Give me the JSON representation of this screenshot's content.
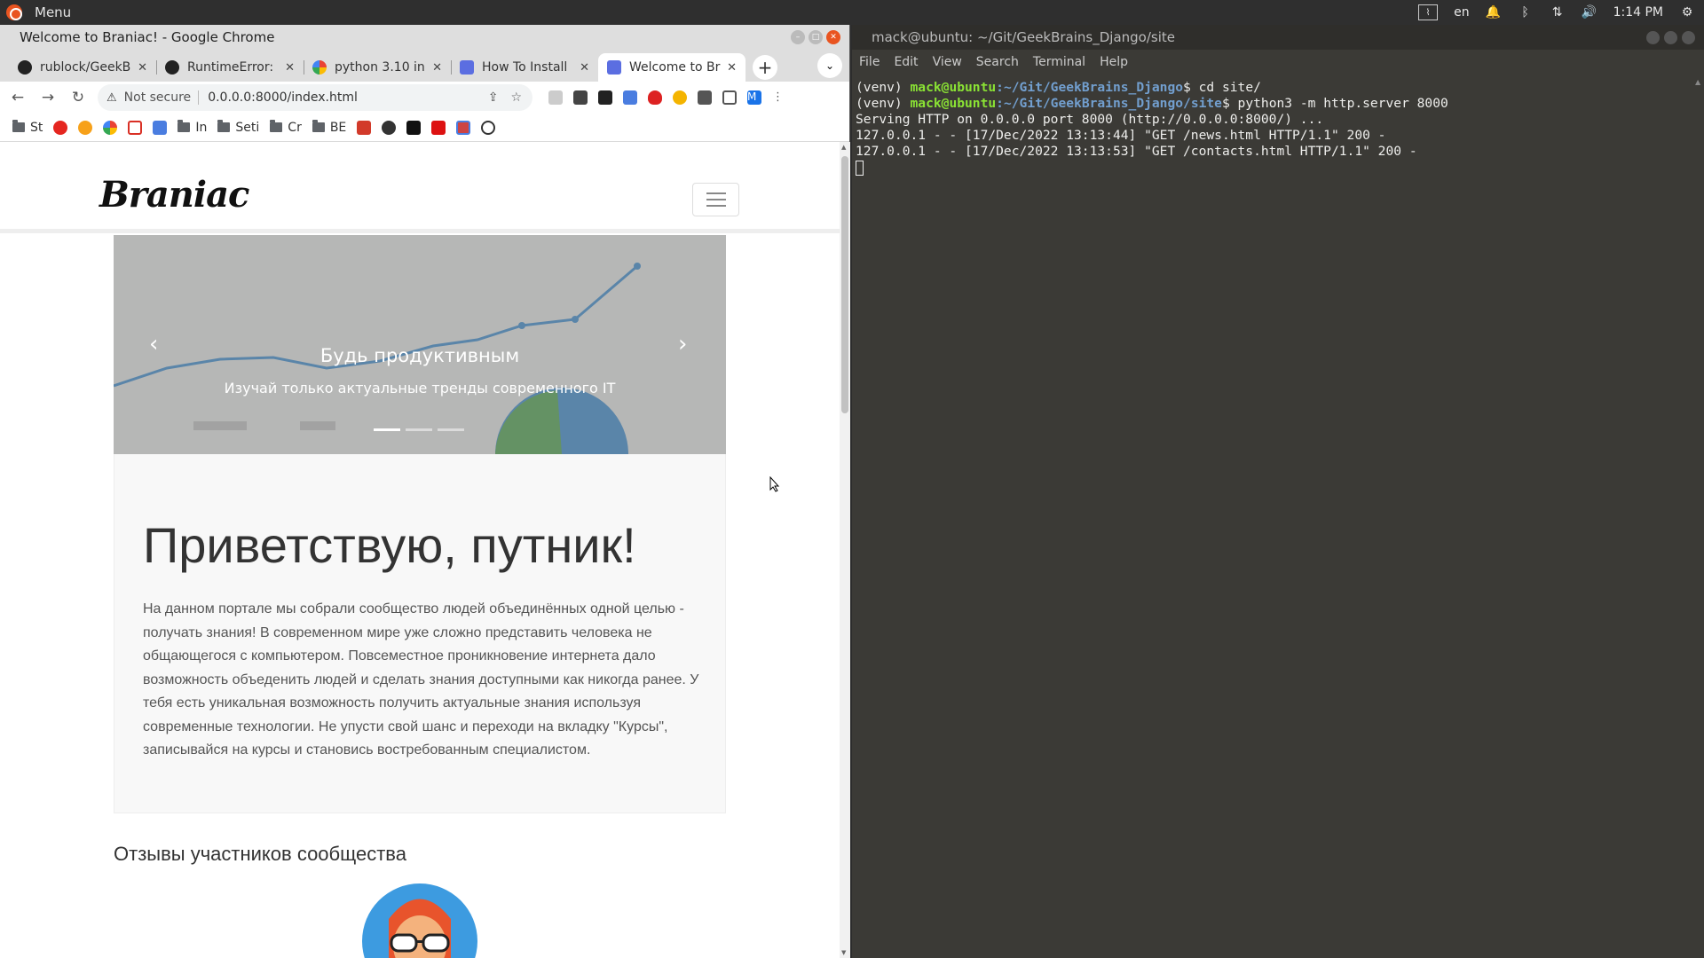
{
  "system_bar": {
    "menu_label": "Menu",
    "language": "en",
    "time": "1:14 PM"
  },
  "browser": {
    "window_title": "Welcome to Braniac! - Google Chrome",
    "tabs": [
      {
        "label": "rublock/GeekB",
        "icon": "github-icon"
      },
      {
        "label": "RuntimeError:",
        "icon": "github-icon"
      },
      {
        "label": "python 3.10 in",
        "icon": "google-icon"
      },
      {
        "label": "How To Install",
        "icon": "docs-icon"
      },
      {
        "label": "Welcome to Br",
        "icon": "site-icon",
        "active": true
      }
    ],
    "address": {
      "security_label": "Not secure",
      "url": "0.0.0.0:8000/index.html"
    },
    "profile_initial": "M",
    "bookmarks": [
      "St",
      "In",
      "Seti",
      "Cr",
      "BE"
    ]
  },
  "site": {
    "brand": "Braniac",
    "carousel": {
      "title": "Будь продуктивным",
      "subtitle": "Изучай только актуальные тренды современного IT",
      "slide_count": 3,
      "active_slide": 1
    },
    "jumbotron": {
      "heading": "Приветствую, путник!",
      "text": "На данном портале мы собрали сообщество людей объединённых одной целью - получать знания! В современном мире уже сложно представить человека не общающегося с компьютером. Повсеместное проникновение интернета дало возможность объеденить людей и сделать знания доступными как никогда ранее. У тебя есть уникальная возможность получить актуальные знания используя современные технологии. Не упусти свой шанс и переходи на вкладку \"Курсы\", записывайся на курсы и становись востребованным специалистом."
    },
    "reviews_title": "Отзывы участников сообщества"
  },
  "terminal": {
    "window_title": "mack@ubuntu: ~/Git/GeekBrains_Django/site",
    "menu": [
      "File",
      "Edit",
      "View",
      "Search",
      "Terminal",
      "Help"
    ],
    "lines": [
      {
        "venv": "(venv) ",
        "user": "mack@ubuntu",
        "path": ":~/Git/GeekBrains_Django",
        "cmd": "$ cd site/"
      },
      {
        "venv": "(venv) ",
        "user": "mack@ubuntu",
        "path": ":~/Git/GeekBrains_Django/site",
        "cmd": "$ python3 -m http.server 8000"
      },
      {
        "text": "Serving HTTP on 0.0.0.0 port 8000 (http://0.0.0.0:8000/) ..."
      },
      {
        "text": "127.0.0.1 - - [17/Dec/2022 13:13:44] \"GET /news.html HTTP/1.1\" 200 -"
      },
      {
        "text": "127.0.0.1 - - [17/Dec/2022 13:13:53] \"GET /contacts.html HTTP/1.1\" 200 -"
      }
    ]
  }
}
